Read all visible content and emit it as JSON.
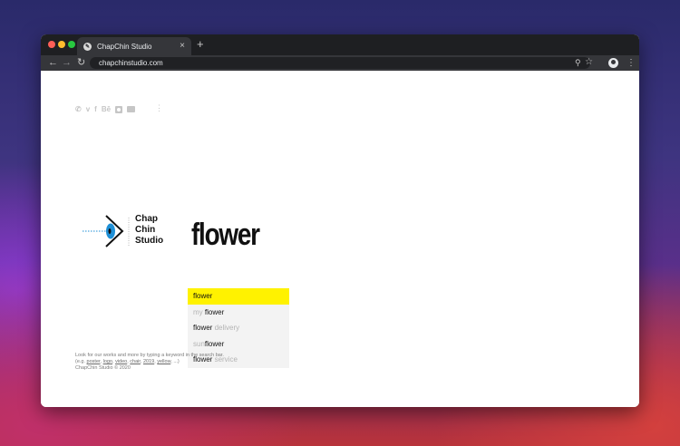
{
  "browser": {
    "tab_title": "ChapChin Studio",
    "tab_close": "×",
    "new_tab": "+",
    "url": "chapchinstudio.com"
  },
  "icons": {
    "back": "arrow-left-icon",
    "forward": "arrow-right-icon",
    "reload": "reload-icon",
    "zoom": "magnifier-icon",
    "bookmark": "star-icon",
    "profile": "profile-icon",
    "menu": "kebab-menu-icon"
  },
  "social": {
    "behance": "Bē",
    "facebook": "f",
    "vimeo": "v",
    "phone": "✆"
  },
  "logo": {
    "line1": "Chap",
    "line2": "Chin",
    "line3": "Studio"
  },
  "search": {
    "value": "flower"
  },
  "suggestions": [
    {
      "pre": "",
      "match": "flower",
      "post": ""
    },
    {
      "pre": "my ",
      "match": "flower",
      "post": ""
    },
    {
      "pre": "",
      "match": "flower",
      "post": " delivery"
    },
    {
      "pre": "sun",
      "match": "flower",
      "post": ""
    },
    {
      "pre": "",
      "match": "flower",
      "post": " service"
    }
  ],
  "footer": {
    "line1": "Look for our works and more by typing a keyword in the search bar.",
    "eg_prefix": "(e.g. ",
    "examples": [
      "poster",
      "logo",
      "video",
      "chair",
      "2019",
      "yellow"
    ],
    "eg_suffix": ", ...)",
    "copyright": "ChapChin Studio © 2020"
  },
  "colors": {
    "highlight": "#fff200",
    "logo_blue": "#1e8fd6"
  }
}
